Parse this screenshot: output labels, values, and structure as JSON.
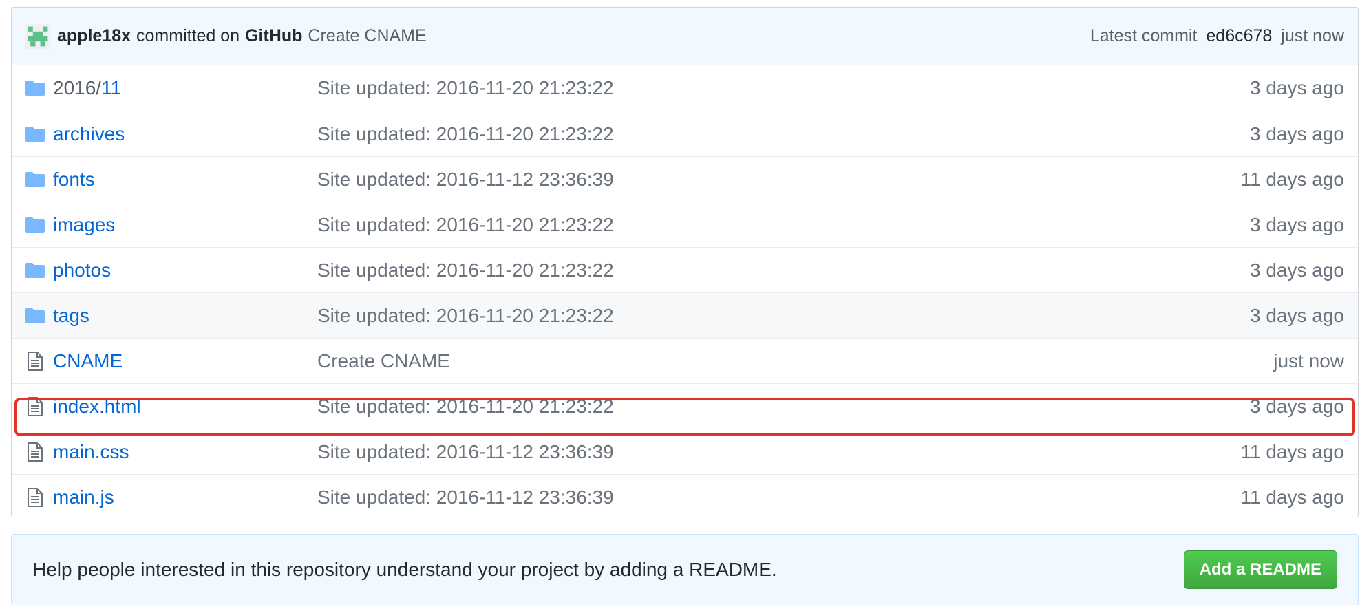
{
  "commit": {
    "author": "apple18x",
    "committed_on": "committed on",
    "via": "GitHub",
    "message": "Create CNAME",
    "latest_label": "Latest commit",
    "sha": "ed6c678",
    "time": "just now"
  },
  "files": [
    {
      "type": "folder",
      "prefix": "2016/",
      "name": "11",
      "message": "Site updated: 2016-11-20 21:23:22",
      "age": "3 days ago"
    },
    {
      "type": "folder",
      "prefix": "",
      "name": "archives",
      "message": "Site updated: 2016-11-20 21:23:22",
      "age": "3 days ago"
    },
    {
      "type": "folder",
      "prefix": "",
      "name": "fonts",
      "message": "Site updated: 2016-11-12 23:36:39",
      "age": "11 days ago"
    },
    {
      "type": "folder",
      "prefix": "",
      "name": "images",
      "message": "Site updated: 2016-11-20 21:23:22",
      "age": "3 days ago"
    },
    {
      "type": "folder",
      "prefix": "",
      "name": "photos",
      "message": "Site updated: 2016-11-20 21:23:22",
      "age": "3 days ago"
    },
    {
      "type": "folder",
      "prefix": "",
      "name": "tags",
      "message": "Site updated: 2016-11-20 21:23:22",
      "age": "3 days ago"
    },
    {
      "type": "file",
      "prefix": "",
      "name": "CNAME",
      "message": "Create CNAME",
      "age": "just now"
    },
    {
      "type": "file",
      "prefix": "",
      "name": "index.html",
      "message": "Site updated: 2016-11-20 21:23:22",
      "age": "3 days ago"
    },
    {
      "type": "file",
      "prefix": "",
      "name": "main.css",
      "message": "Site updated: 2016-11-12 23:36:39",
      "age": "11 days ago"
    },
    {
      "type": "file",
      "prefix": "",
      "name": "main.js",
      "message": "Site updated: 2016-11-12 23:36:39",
      "age": "11 days ago"
    }
  ],
  "readme": {
    "text": "Help people interested in this repository understand your project by adding a README.",
    "button_label": "Add a README"
  },
  "colors": {
    "link": "#0366d6",
    "highlight": "#e5312b",
    "button": "#40a840"
  }
}
